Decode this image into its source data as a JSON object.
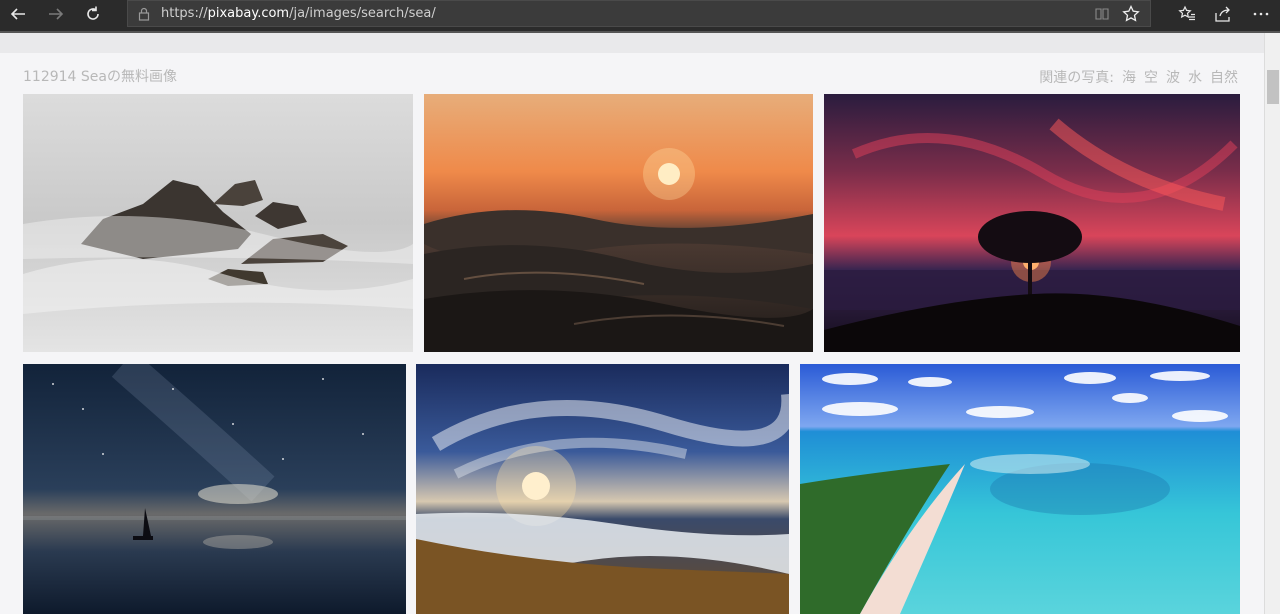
{
  "browser": {
    "url_prefix": "https://",
    "url_domain": "pixabay.com",
    "url_path": "/ja/images/search/sea/",
    "icons": [
      "back-arrow-icon",
      "forward-arrow-icon",
      "refresh-icon",
      "lock-icon",
      "reading-view-icon",
      "favorite-star-icon",
      "favorites-list-icon",
      "share-icon",
      "more-icon"
    ]
  },
  "results": {
    "title": "112914 Seaの無料画像",
    "related_label": "関連の写真:",
    "related_tags": [
      "海",
      "空",
      "波",
      "水",
      "自然"
    ]
  },
  "photos": [
    {
      "subject": "misty rocks in sea"
    },
    {
      "subject": "sunset over waves"
    },
    {
      "subject": "tree silhouette at sunset"
    },
    {
      "subject": "starry night sailboat"
    },
    {
      "subject": "beach sunrise waves"
    },
    {
      "subject": "tropical island lagoon"
    }
  ]
}
